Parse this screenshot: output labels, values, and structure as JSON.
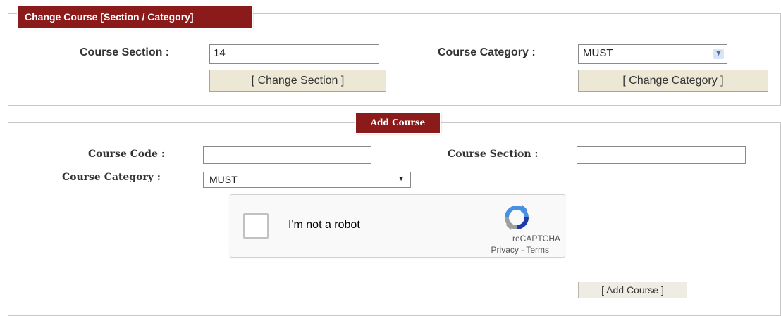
{
  "change_panel": {
    "legend": "Change Course [Section / Category]",
    "section_label": "Course Section :",
    "section_value": "14",
    "change_section_button": "[ Change Section ]",
    "category_label": "Course Category :",
    "category_value": "MUST",
    "change_category_button": "[ Change Category ]"
  },
  "add_panel": {
    "legend": "Add Course",
    "code_label": "Course Code :",
    "code_value": "",
    "section_label": "Course Section :",
    "section_value": "",
    "category_label": "Course Category :",
    "category_value": "MUST",
    "captcha": {
      "text": "I'm not a robot",
      "brand": "reCAPTCHA",
      "links": "Privacy - Terms"
    },
    "add_button": "[ Add Course ]"
  },
  "colors": {
    "legend_bg": "#8b1a1a",
    "button_bg": "#ece8d5"
  }
}
